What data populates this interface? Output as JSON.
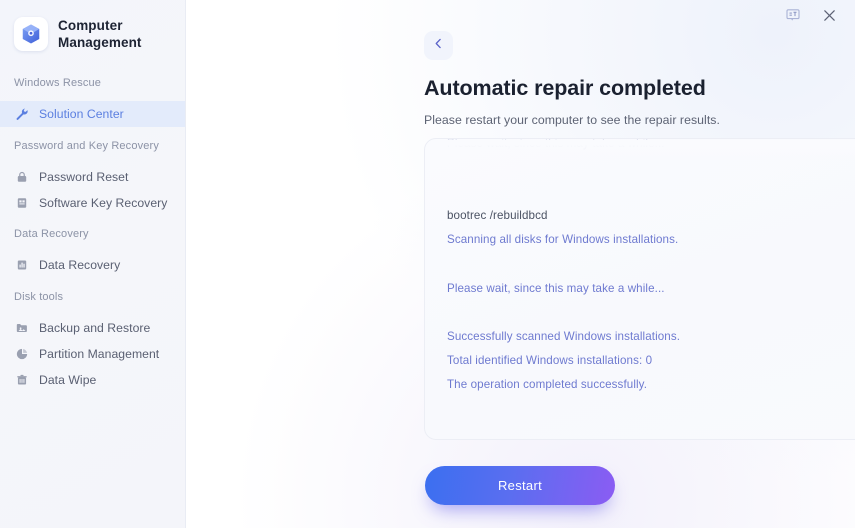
{
  "app": {
    "brand_title": "Computer Management"
  },
  "window_controls": {
    "feedback_icon": "feedback-message-icon",
    "close_icon": "close-icon"
  },
  "sidebar": {
    "groups": [
      {
        "label": "Windows Rescue",
        "items": [
          {
            "label": "Solution Center",
            "icon": "wrench-icon",
            "active": true
          }
        ]
      },
      {
        "label": "Password and Key Recovery",
        "items": [
          {
            "label": "Password Reset",
            "icon": "lock-icon",
            "active": false
          },
          {
            "label": "Software Key Recovery",
            "icon": "key-document-icon",
            "active": false
          }
        ]
      },
      {
        "label": "Data Recovery",
        "items": [
          {
            "label": "Data Recovery",
            "icon": "chart-document-icon",
            "active": false
          }
        ]
      },
      {
        "label": "Disk tools",
        "items": [
          {
            "label": "Backup and Restore",
            "icon": "folder-icon",
            "active": false
          },
          {
            "label": "Partition Management",
            "icon": "pie-chart-icon",
            "active": false
          },
          {
            "label": "Data Wipe",
            "icon": "trash-bin-icon",
            "active": false
          }
        ]
      }
    ]
  },
  "main": {
    "back_icon": "chevron-left-icon",
    "title": "Automatic repair completed",
    "subtitle": "Please restart your computer to see the repair results.",
    "restart_label": "Restart"
  },
  "log": {
    "lines": [
      {
        "text": "Please wait, since this may take a while...",
        "style": "faded"
      },
      {
        "text": "bootrec /rebuildbcd",
        "style": "cmd"
      },
      {
        "text": "Scanning all disks for Windows installations.",
        "style": "info"
      },
      {
        "text": "Please wait, since this may take a while...",
        "style": "info"
      },
      {
        "text": "Successfully scanned Windows installations.",
        "style": "info"
      },
      {
        "text": "Total identified Windows installations: 0",
        "style": "info"
      },
      {
        "text": "The operation completed successfully.",
        "style": "info"
      }
    ]
  },
  "colors": {
    "accent_blue": "#5b7fe0",
    "log_text": "#6e7ad0",
    "button_gradient_start": "#3b6ff0",
    "button_gradient_end": "#8b5cf3",
    "sidebar_active_bg": "#e3ebfb"
  }
}
